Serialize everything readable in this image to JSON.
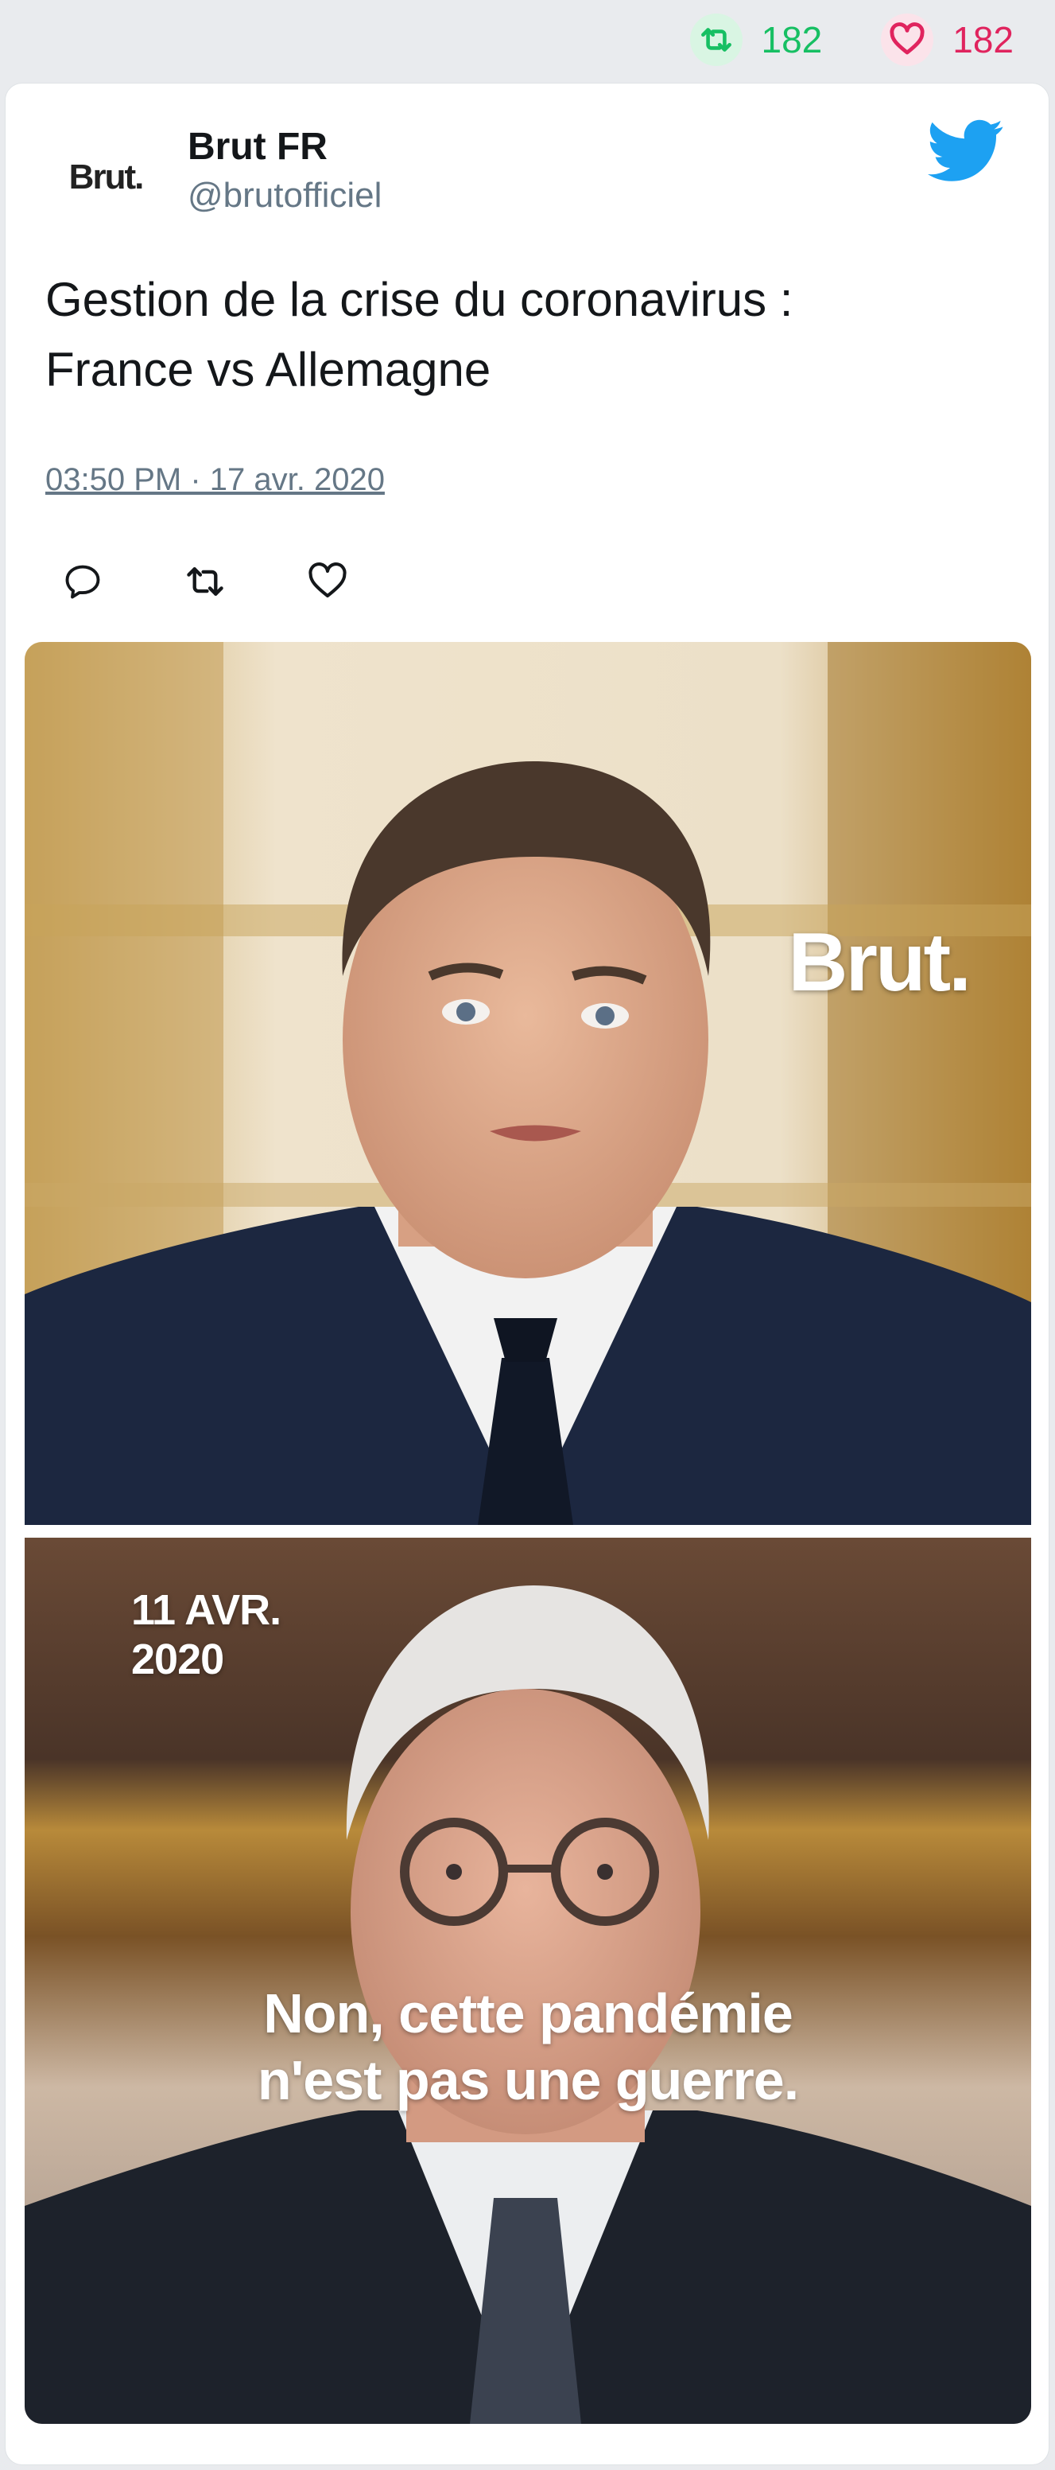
{
  "stats": {
    "retweets": "182",
    "likes": "182"
  },
  "tweet": {
    "avatar_text": "Brut.",
    "display_name": "Brut FR",
    "handle": "@brutofficiel",
    "text_line1": "Gestion de la crise du coronavirus :",
    "text_line2": "France vs Allemagne",
    "timestamp": "03:50 PM · 17 avr. 2020"
  },
  "media": {
    "watermark": "Brut.",
    "date_line1": "11 AVR.",
    "date_line2": "2020",
    "caption_line1": "Non, cette pandémie",
    "caption_line2": "n'est pas une guerre."
  },
  "colors": {
    "retweet_green": "#17bf63",
    "like_pink": "#e0245e",
    "twitter_blue": "#1da1f2",
    "muted_text": "#657786"
  },
  "icons": {
    "retweet": "retweet-icon",
    "like": "heart-icon",
    "reply": "reply-icon",
    "brand": "twitter-bird-icon"
  }
}
